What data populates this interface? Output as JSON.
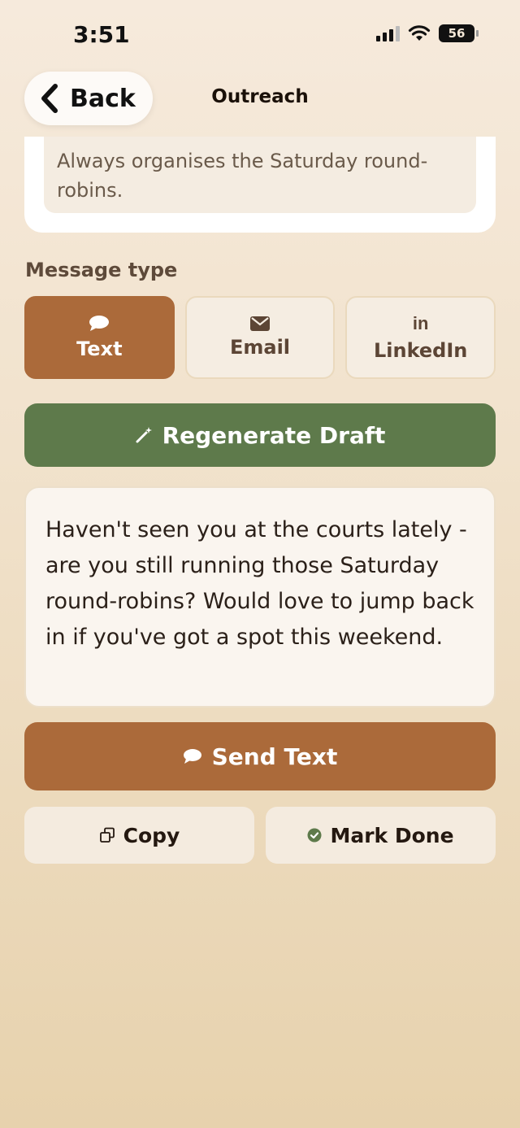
{
  "status_bar": {
    "time": "3:51",
    "battery_level": "56",
    "icons": [
      "signal-icon",
      "wifi-icon",
      "battery-icon"
    ]
  },
  "nav": {
    "back_label": "Back",
    "title": "Outreach"
  },
  "note": {
    "text": "Always organises the Saturday round-robins."
  },
  "message_type": {
    "label": "Message type",
    "options": [
      {
        "label": "Text",
        "icon": "chat-bubble-icon",
        "selected": true
      },
      {
        "label": "Email",
        "icon": "envelope-icon",
        "selected": false
      },
      {
        "label": "LinkedIn",
        "icon": "linkedin-icon",
        "icon_text": "in",
        "selected": false
      }
    ]
  },
  "regenerate": {
    "label": "Regenerate Draft",
    "icon": "magic-wand-icon"
  },
  "draft": {
    "text": "Haven't seen you at the courts lately - are you still running those Saturday round-robins? Would love to jump back in if you've got a spot this weekend."
  },
  "send": {
    "label": "Send Text",
    "icon": "chat-bubble-icon"
  },
  "actions": {
    "copy_label": "Copy",
    "mark_done_label": "Mark Done"
  },
  "colors": {
    "accent_brown": "#ab6a3a",
    "accent_green": "#5e7a4b",
    "background_top": "#f6eadc",
    "background_bottom": "#e7d2ad"
  }
}
